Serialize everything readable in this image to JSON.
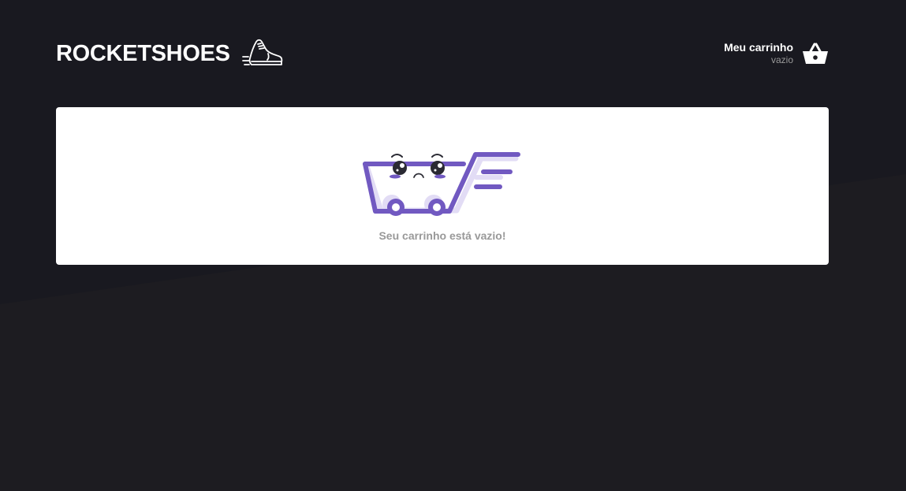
{
  "header": {
    "logo_text": "ROCKETSHOES",
    "logo_icon": "sneaker-icon",
    "cart_title": "Meu carrinho",
    "cart_count": "vazio",
    "cart_icon": "shopping-basket-icon"
  },
  "cart": {
    "illustration": "sad-shopping-cart-icon",
    "empty_message": "Seu carrinho está vazio!"
  },
  "colors": {
    "background": "#1d1c21",
    "background_shape": "#191920",
    "accent": "#7159c1",
    "accent_light": "#e2dcf5",
    "text_muted": "#999999",
    "white": "#ffffff"
  }
}
